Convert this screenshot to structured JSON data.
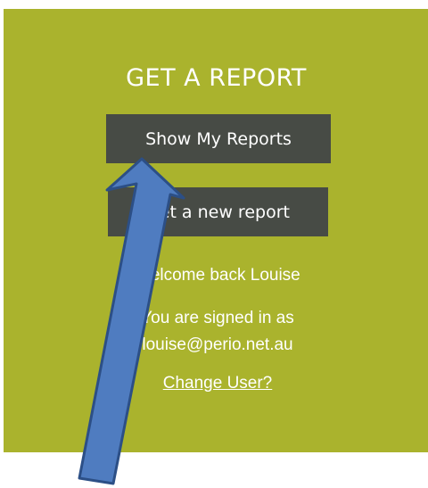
{
  "panel": {
    "heading": "GET A REPORT",
    "show_reports_label": "Show My Reports",
    "new_report_label": "Get a new report",
    "welcome_text": "Welcome back Louise",
    "signed_in_label": "You are signed in as",
    "signed_in_email": "louise@perio.net.au",
    "change_user_link": "Change User?"
  },
  "colors": {
    "panel_bg": "#aab32d",
    "button_bg": "#474b45",
    "arrow_fill": "#4f7cc0",
    "arrow_stroke": "#2c4f86"
  }
}
